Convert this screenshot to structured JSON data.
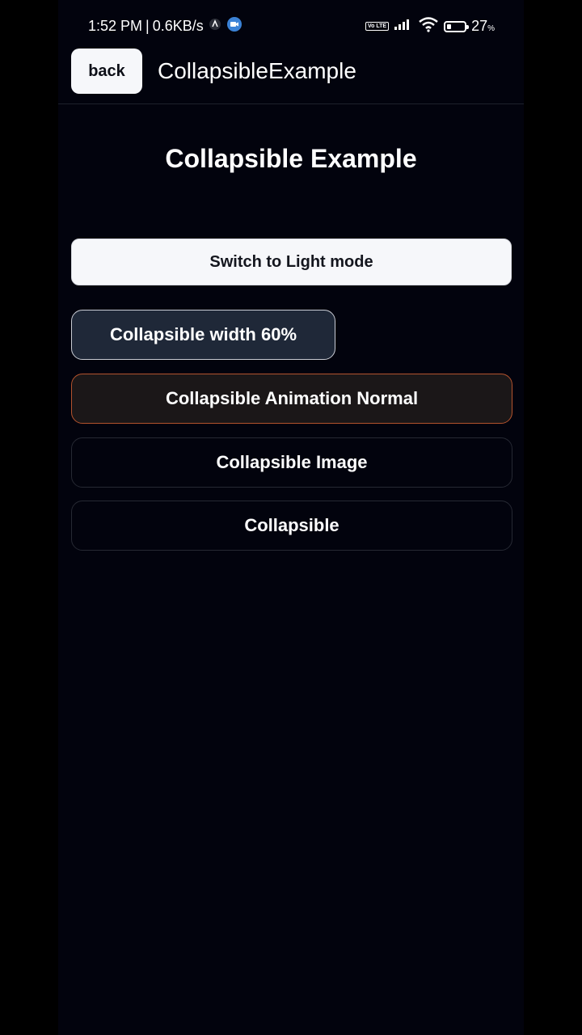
{
  "status_bar": {
    "time": "1:52 PM",
    "separator": "|",
    "network_speed": "0.6KB/s",
    "icons": [
      "notification-icon",
      "video-app-icon",
      "volte-icon",
      "signal-icon",
      "wifi-icon",
      "battery-icon"
    ],
    "volte_label": "Vo LTE",
    "battery_level": 27,
    "battery_text": "27",
    "battery_unit": "%"
  },
  "header": {
    "back_label": "back",
    "title": "CollapsibleExample"
  },
  "main": {
    "title": "Collapsible Example",
    "buttons": [
      {
        "label": "Switch to Light mode"
      },
      {
        "label": "Collapsible width 60%"
      },
      {
        "label": "Collapsible Animation Normal"
      },
      {
        "label": "Collapsible Image"
      },
      {
        "label": "Collapsible"
      }
    ]
  },
  "colors": {
    "background": "#02030d",
    "light_button": "#f6f7fa",
    "width_button": "#1f2838",
    "animation_border": "#b4532d"
  }
}
